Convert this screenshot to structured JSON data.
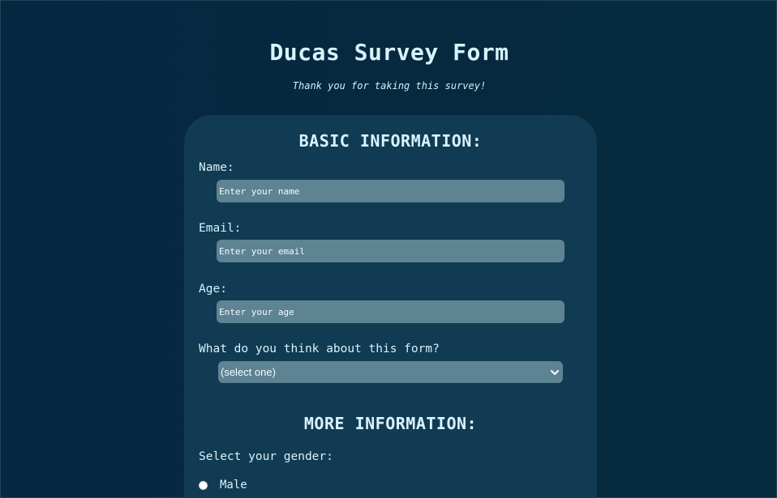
{
  "header": {
    "title": "Ducas Survey Form",
    "subtitle": "Thank you for taking this survey!"
  },
  "basic_section": {
    "heading": "BASIC INFORMATION:",
    "name": {
      "label": "Name:",
      "placeholder": "Enter your name",
      "value": ""
    },
    "email": {
      "label": "Email:",
      "placeholder": "Enter your email",
      "value": ""
    },
    "age": {
      "label": "Age:",
      "placeholder": "Enter your age",
      "value": ""
    },
    "opinion": {
      "label": "What do you think about this form?",
      "selected": "(select one)"
    }
  },
  "more_section": {
    "heading": "MORE INFORMATION:",
    "gender_label": "Select your gender:",
    "gender_options": [
      "Male"
    ]
  },
  "icons": {
    "select_arrow": "chevron-down-icon"
  },
  "colors": {
    "page_background": "#052740",
    "card_background": "#113b52",
    "input_background": "#5e8393",
    "text": "#d8f1fb"
  }
}
